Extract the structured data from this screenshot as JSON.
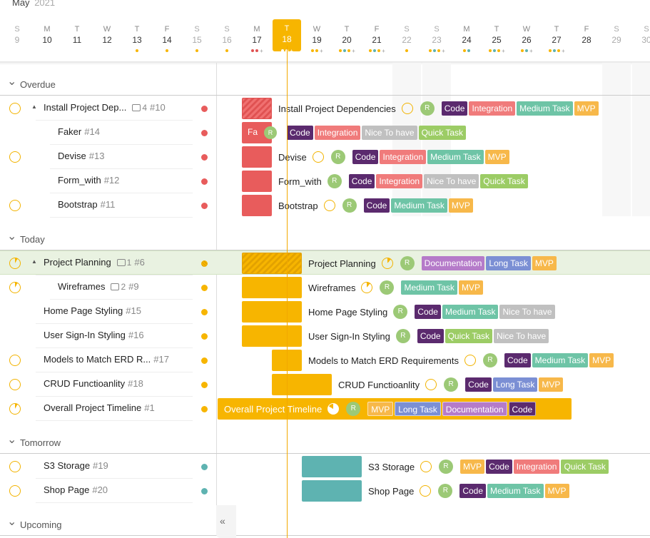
{
  "calendar": {
    "month": "May",
    "year": "2021",
    "days": [
      {
        "dow": "S",
        "num": "9",
        "weekend": true,
        "dots": []
      },
      {
        "dow": "M",
        "num": "10",
        "weekend": false,
        "dots": []
      },
      {
        "dow": "T",
        "num": "11",
        "weekend": false,
        "dots": []
      },
      {
        "dow": "W",
        "num": "12",
        "weekend": false,
        "dots": []
      },
      {
        "dow": "T",
        "num": "13",
        "weekend": false,
        "dots": [
          "#f7b500"
        ]
      },
      {
        "dow": "F",
        "num": "14",
        "weekend": false,
        "dots": [
          "#f7b500"
        ]
      },
      {
        "dow": "S",
        "num": "15",
        "weekend": true,
        "dots": [
          "#f7b500"
        ]
      },
      {
        "dow": "S",
        "num": "16",
        "weekend": true,
        "dots": [
          "#f7b500"
        ]
      },
      {
        "dow": "M",
        "num": "17",
        "weekend": false,
        "dots": [
          "#e05252",
          "#e05252"
        ],
        "more": "+"
      },
      {
        "dow": "T",
        "num": "18",
        "weekend": false,
        "today": true,
        "dots": [
          "#fff",
          "#fff"
        ],
        "more": "+"
      },
      {
        "dow": "W",
        "num": "19",
        "weekend": false,
        "dots": [
          "#f7b500",
          "#f7b500"
        ],
        "more": "+"
      },
      {
        "dow": "T",
        "num": "20",
        "weekend": false,
        "dots": [
          "#f7b500",
          "#5eb3b1",
          "#f7b500"
        ],
        "more": "+"
      },
      {
        "dow": "F",
        "num": "21",
        "weekend": false,
        "dots": [
          "#f7b500",
          "#5eb3b1",
          "#f7b500"
        ],
        "more": "+"
      },
      {
        "dow": "S",
        "num": "22",
        "weekend": true,
        "dots": [
          "#f7b500"
        ]
      },
      {
        "dow": "S",
        "num": "23",
        "weekend": true,
        "dots": [
          "#f7b500",
          "#5eb3b1",
          "#f7b500"
        ],
        "more": "+"
      },
      {
        "dow": "M",
        "num": "24",
        "weekend": false,
        "dots": [
          "#f7b500",
          "#5eb3b1"
        ]
      },
      {
        "dow": "T",
        "num": "25",
        "weekend": false,
        "dots": [
          "#f7b500",
          "#5eb3b1",
          "#f7b500"
        ],
        "more": "+"
      },
      {
        "dow": "W",
        "num": "26",
        "weekend": false,
        "dots": [
          "#f7b500",
          "#5eb3b1"
        ],
        "more": "+"
      },
      {
        "dow": "T",
        "num": "27",
        "weekend": false,
        "dots": [
          "#f7b500",
          "#5eb3b1",
          "#f7b500"
        ],
        "more": "+"
      },
      {
        "dow": "F",
        "num": "28",
        "weekend": false,
        "dots": []
      },
      {
        "dow": "S",
        "num": "29",
        "weekend": true,
        "dots": []
      },
      {
        "dow": "S",
        "num": "30",
        "weekend": true,
        "dots": []
      }
    ]
  },
  "colors": {
    "code": "#5b2a6e",
    "integration": "#f07b7b",
    "medium_task": "#6ec4a6",
    "mvp": "#f7b84a",
    "nice_to_have": "#c0c0c0",
    "quick_task": "#9ccc65",
    "documentation": "#b57bc9",
    "long_task": "#7b8fd4",
    "overdue": "#e85c5c",
    "today": "#f7b500",
    "tomorrow": "#5eb3b1"
  },
  "groups": [
    {
      "key": "overdue",
      "name": "Overdue"
    },
    {
      "key": "today",
      "name": "Today"
    },
    {
      "key": "tomorrow",
      "name": "Tomorrow"
    },
    {
      "key": "upcoming",
      "name": "Upcoming"
    }
  ],
  "tasks": [
    {
      "name": "Install Project Dep...",
      "full_name": "Install Project Dependencies",
      "num": "#10",
      "subcount": "4",
      "group": "overdue",
      "circle": true,
      "expand": true,
      "indent": false,
      "tags": [
        "Code",
        "Integration",
        "Medium Task",
        "MVP"
      ]
    },
    {
      "name": "Faker",
      "full_name": "Fa",
      "num": "#14",
      "group": "overdue",
      "circle": false,
      "indent": true,
      "tags": [
        "Code",
        "Integration",
        "Nice To have",
        "Quick Task"
      ]
    },
    {
      "name": "Devise",
      "full_name": "Devise",
      "num": "#13",
      "group": "overdue",
      "circle": true,
      "indent": true,
      "tags": [
        "Code",
        "Integration",
        "Medium Task",
        "MVP"
      ]
    },
    {
      "name": "Form_with",
      "full_name": "Form_with",
      "num": "#12",
      "group": "overdue",
      "circle": false,
      "indent": true,
      "tags": [
        "Code",
        "Integration",
        "Nice To have",
        "Quick Task"
      ]
    },
    {
      "name": "Bootstrap",
      "full_name": "Bootstrap",
      "num": "#11",
      "group": "overdue",
      "circle": true,
      "indent": true,
      "tags": [
        "Code",
        "Medium Task",
        "MVP"
      ]
    },
    {
      "name": "Project Planning",
      "full_name": "Project Planning",
      "num": "#6",
      "subcount": "1",
      "group": "today",
      "circle": true,
      "expand": true,
      "indent": false,
      "tags": [
        "Documentation",
        "Long Task",
        "MVP"
      ]
    },
    {
      "name": "Wireframes",
      "full_name": "Wireframes",
      "num": "#9",
      "subcount": "2",
      "group": "today",
      "circle": true,
      "indent": true,
      "tags": [
        "Medium Task",
        "MVP"
      ]
    },
    {
      "name": "Home Page Styling",
      "full_name": "Home Page Styling",
      "num": "#15",
      "group": "today",
      "circle": false,
      "indent": false,
      "tags": [
        "Code",
        "Medium Task",
        "Nice To have"
      ]
    },
    {
      "name": "User Sign-In Styling",
      "full_name": "User Sign-In Styling",
      "num": "#16",
      "group": "today",
      "circle": false,
      "indent": false,
      "tags": [
        "Code",
        "Quick Task",
        "Nice To have"
      ]
    },
    {
      "name": "Models to Match ERD R...",
      "full_name": "Models to Match ERD Requirements",
      "num": "#17",
      "group": "today",
      "circle": true,
      "indent": false,
      "tags": [
        "Code",
        "Medium Task",
        "MVP"
      ]
    },
    {
      "name": "CRUD Functioanlity",
      "full_name": "CRUD Functioanlity",
      "num": "#18",
      "group": "today",
      "circle": true,
      "indent": false,
      "tags": [
        "Code",
        "Long Task",
        "MVP"
      ]
    },
    {
      "name": "Overall Project Timeline",
      "full_name": "Overall Project Timeline",
      "num": "#1",
      "group": "today",
      "circle": true,
      "indent": false,
      "tags": [
        "MVP",
        "Long Task",
        "Documentation",
        "Code"
      ]
    },
    {
      "name": "S3 Storage",
      "full_name": "S3 Storage",
      "num": "#19",
      "group": "tomorrow",
      "circle": true,
      "indent": false,
      "tags": [
        "MVP",
        "Code",
        "Integration",
        "Quick Task"
      ]
    },
    {
      "name": "Shop Page",
      "full_name": "Shop Page",
      "num": "#20",
      "group": "tomorrow",
      "circle": true,
      "indent": false,
      "tags": [
        "Code",
        "Medium Task",
        "MVP"
      ]
    }
  ],
  "avatar_initial": "R",
  "collapse_glyph": "«"
}
